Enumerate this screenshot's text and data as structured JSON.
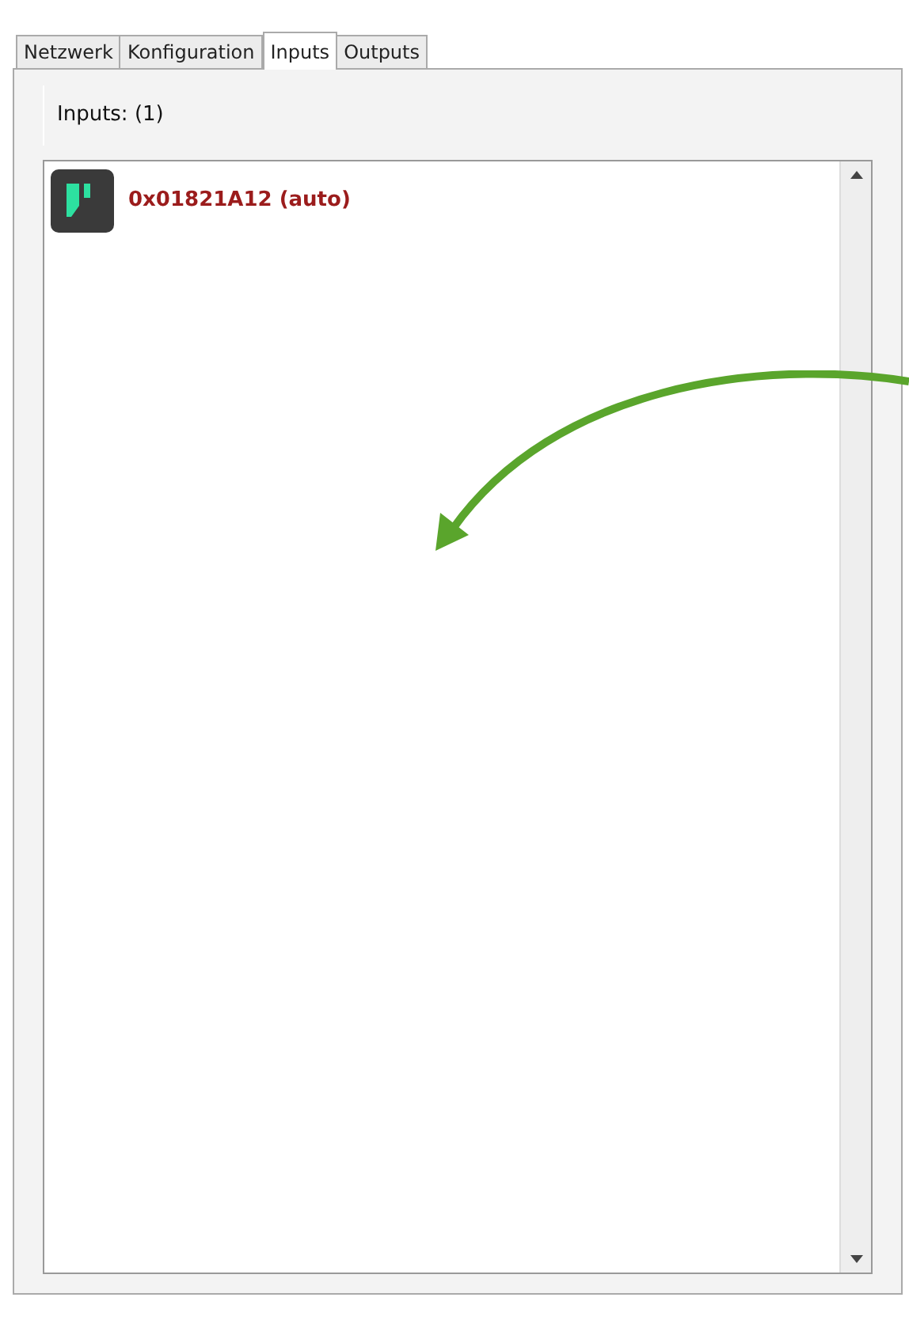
{
  "tabs": [
    {
      "label": "Netzwerk",
      "selected": false
    },
    {
      "label": "Konfiguration",
      "selected": false
    },
    {
      "label": "Inputs",
      "selected": true
    },
    {
      "label": "Outputs",
      "selected": false
    }
  ],
  "panel": {
    "heading": "Inputs: (1)"
  },
  "inputs": [
    {
      "label": "0x01821A12 (auto)"
    }
  ]
}
